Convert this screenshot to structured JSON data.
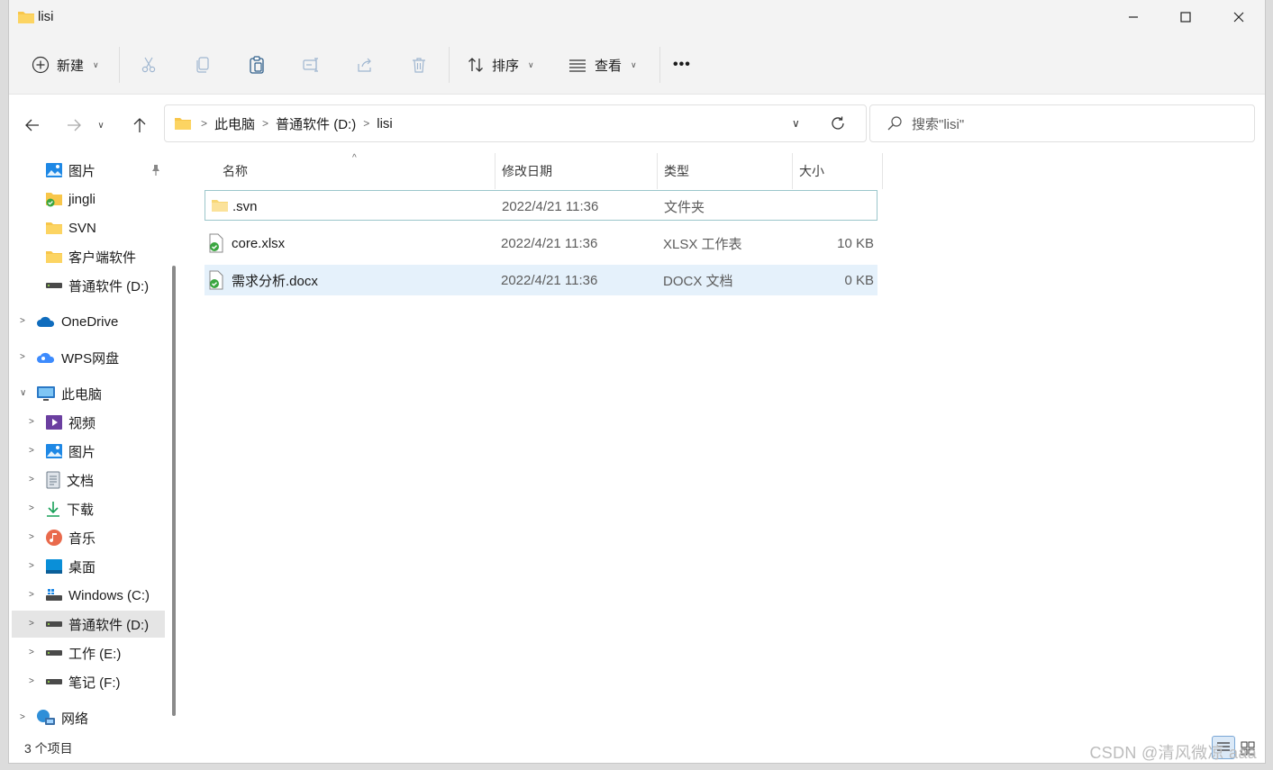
{
  "window": {
    "title": "lisi"
  },
  "toolbar": {
    "new_label": "新建",
    "sort_label": "排序",
    "view_label": "查看",
    "more_label": "•••"
  },
  "address": {
    "crumbs": [
      "此电脑",
      "普通软件 (D:)",
      "lisi"
    ]
  },
  "search": {
    "placeholder": "搜索\"lisi\""
  },
  "sidebar": {
    "items": [
      {
        "label": "图片"
      },
      {
        "label": "jingli"
      },
      {
        "label": "SVN"
      },
      {
        "label": "客户端软件"
      },
      {
        "label": "普通软件 (D:)"
      },
      {
        "label": "OneDrive"
      },
      {
        "label": "WPS网盘"
      },
      {
        "label": "此电脑"
      },
      {
        "label": "视频"
      },
      {
        "label": "图片"
      },
      {
        "label": "文档"
      },
      {
        "label": "下载"
      },
      {
        "label": "音乐"
      },
      {
        "label": "桌面"
      },
      {
        "label": "Windows (C:)"
      },
      {
        "label": "普通软件 (D:)"
      },
      {
        "label": "工作 (E:)"
      },
      {
        "label": "笔记 (F:)"
      },
      {
        "label": "网络"
      }
    ]
  },
  "columns": {
    "name": "名称",
    "modified": "修改日期",
    "type": "类型",
    "size": "大小"
  },
  "files": [
    {
      "name": ".svn",
      "modified": "2022/4/21 11:36",
      "type": "文件夹",
      "size": ""
    },
    {
      "name": "core.xlsx",
      "modified": "2022/4/21 11:36",
      "type": "XLSX 工作表",
      "size": "10 KB"
    },
    {
      "name": "需求分析.docx",
      "modified": "2022/4/21 11:36",
      "type": "DOCX 文档",
      "size": "0 KB"
    }
  ],
  "status": {
    "count": "3 个项目"
  },
  "watermark": "CSDN @清风微凉 aaa",
  "colors": {
    "accent": "#0067c0",
    "folder": "#f8c64a",
    "selected_row": "#e5f1fb",
    "focus_border": "#9bc6cb"
  }
}
